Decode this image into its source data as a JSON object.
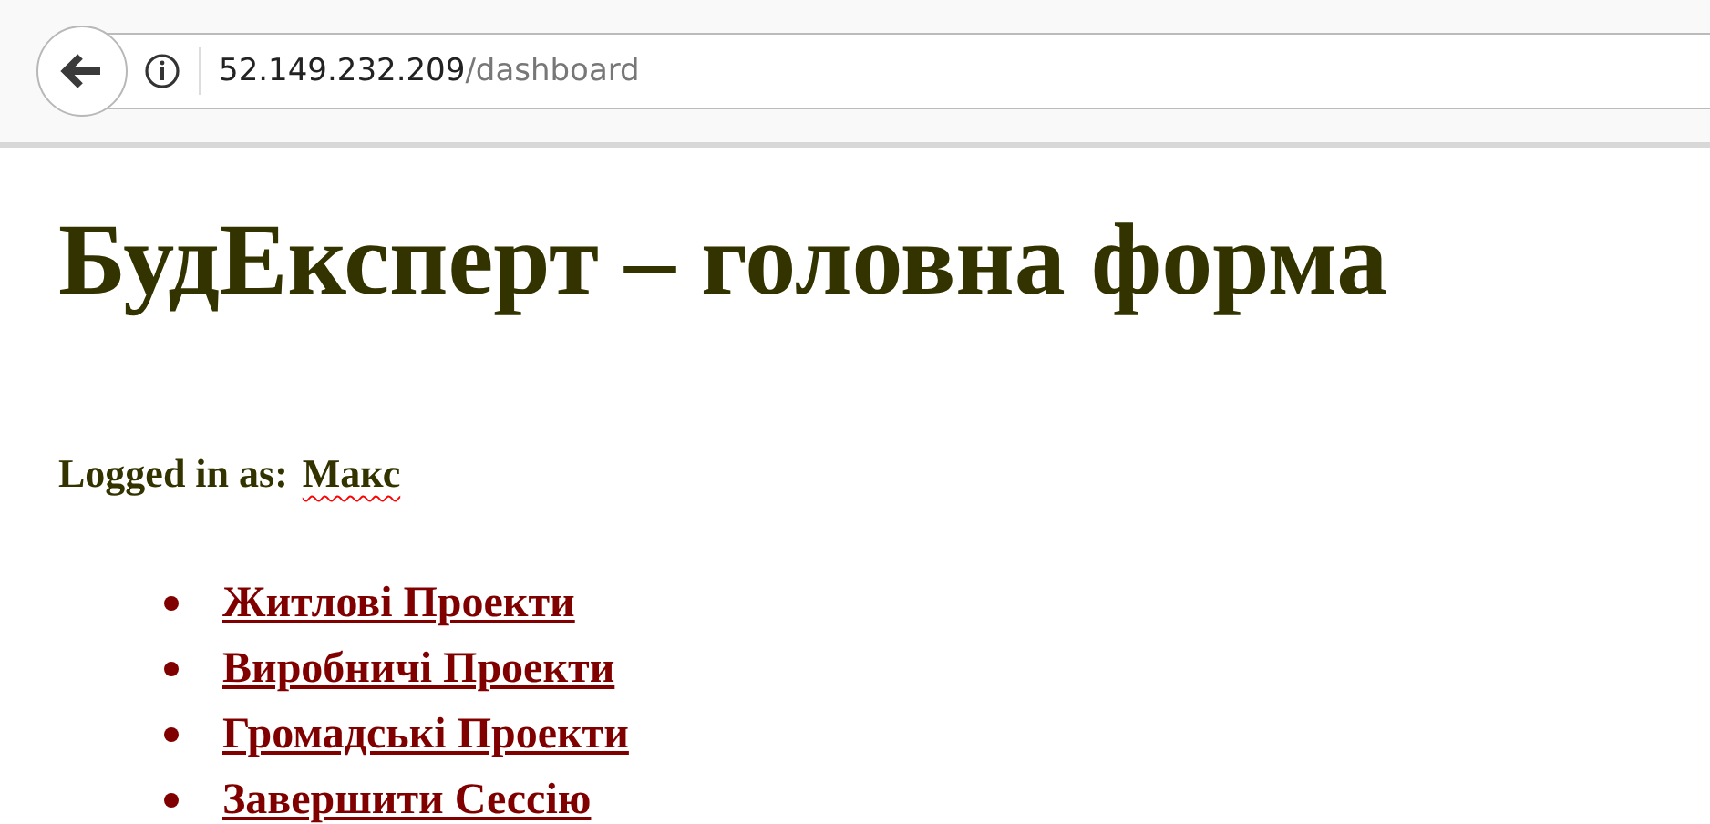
{
  "browser": {
    "url": {
      "host": "52.149.232.209",
      "path": "/dashboard"
    }
  },
  "page": {
    "heading": "БудЕксперт – головна форма",
    "login": {
      "label": "Logged in as:",
      "user": "Макс"
    },
    "links": [
      {
        "label": "Житлові Проекти"
      },
      {
        "label": "Виробничі Проекти"
      },
      {
        "label": "Громадські Проекти"
      },
      {
        "label": "Завершити Сессію"
      }
    ]
  }
}
